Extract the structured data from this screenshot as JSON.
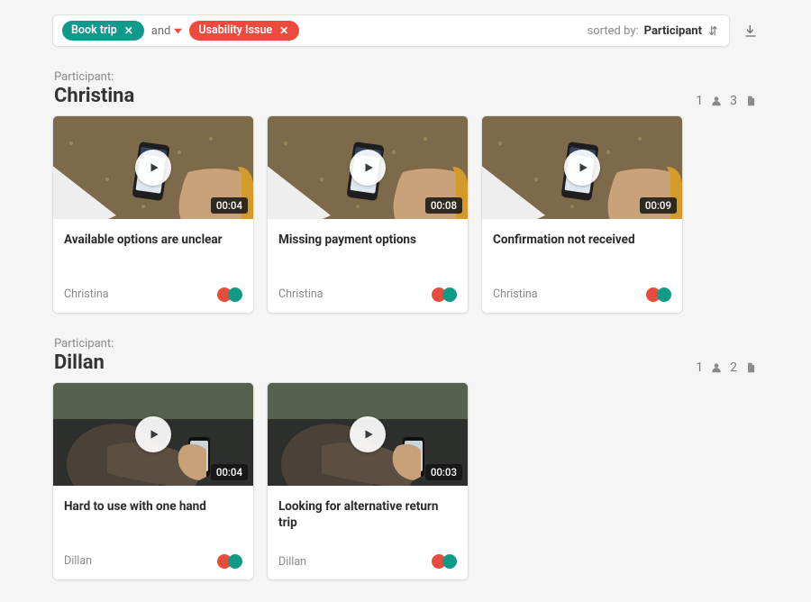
{
  "filter": {
    "tag1": "Book trip",
    "operator": "and",
    "tag2": "Usability Issue",
    "sorted_label": "sorted by:",
    "sorted_value": "Participant"
  },
  "groups": [
    {
      "label": "Participant:",
      "name": "Christina",
      "count1": "1",
      "count2": "3",
      "scene": "phone",
      "clips": [
        {
          "title": "Available options are unclear",
          "duration": "00:04",
          "participant": "Christina"
        },
        {
          "title": "Missing payment options",
          "duration": "00:08",
          "participant": "Christina"
        },
        {
          "title": "Confirmation not received",
          "duration": "00:09",
          "participant": "Christina"
        }
      ]
    },
    {
      "label": "Participant:",
      "name": "Dillan",
      "count1": "1",
      "count2": "2",
      "scene": "couch",
      "clips": [
        {
          "title": "Hard to use with one hand",
          "duration": "00:04",
          "participant": "Dillan"
        },
        {
          "title": "Looking for alternative return trip",
          "duration": "00:03",
          "participant": "Dillan"
        }
      ]
    }
  ],
  "colors": {
    "teal": "#0f9a8c",
    "red": "#f04a3e"
  }
}
